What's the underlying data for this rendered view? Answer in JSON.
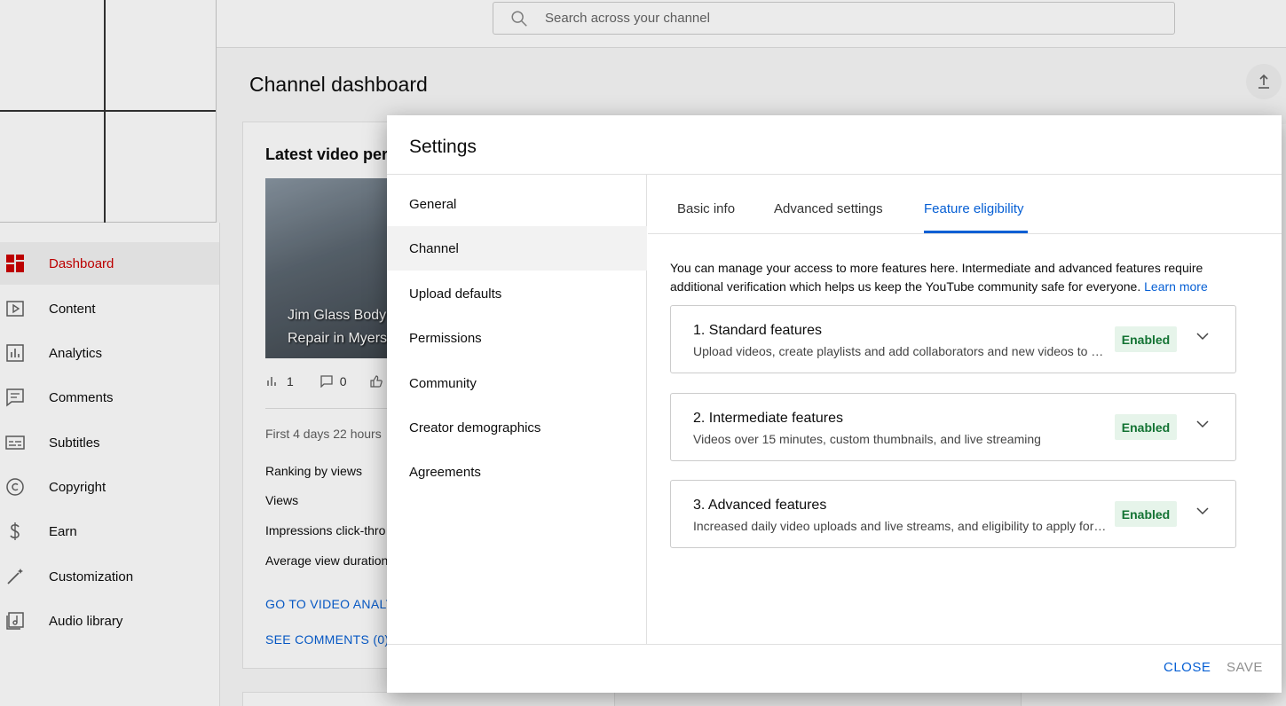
{
  "search": {
    "placeholder": "Search across your channel"
  },
  "page": {
    "title": "Channel dashboard"
  },
  "sidebar": {
    "items": [
      {
        "label": "Dashboard",
        "icon": "dashboard-icon",
        "active": true
      },
      {
        "label": "Content",
        "icon": "content-icon"
      },
      {
        "label": "Analytics",
        "icon": "analytics-icon"
      },
      {
        "label": "Comments",
        "icon": "comments-icon"
      },
      {
        "label": "Subtitles",
        "icon": "subtitles-icon"
      },
      {
        "label": "Copyright",
        "icon": "copyright-icon"
      },
      {
        "label": "Earn",
        "icon": "dollar-icon"
      },
      {
        "label": "Customization",
        "icon": "magic-wand-icon"
      },
      {
        "label": "Audio library",
        "icon": "audio-library-icon"
      }
    ]
  },
  "latest_video": {
    "title": "Latest video per",
    "thumb_line1": "Jim Glass Body",
    "thumb_line2": "Repair in Myers",
    "views_count": "1",
    "comments_count": "0",
    "period": "First 4 days 22 hours",
    "rows": [
      "Ranking by views",
      "Views",
      "Impressions click-thro",
      "Average view duration"
    ],
    "link_analytics": "GO TO VIDEO ANALY",
    "link_comments": "SEE COMMENTS (0)"
  },
  "dialog": {
    "title": "Settings",
    "left_nav": [
      "General",
      "Channel",
      "Upload defaults",
      "Permissions",
      "Community",
      "Creator demographics",
      "Agreements"
    ],
    "active_left": "Channel",
    "tabs": [
      "Basic info",
      "Advanced settings",
      "Feature eligibility"
    ],
    "active_tab": "Feature eligibility",
    "intro_text": "You can manage your access to more features here. Intermediate and advanced features require additional verification which helps us keep the YouTube community safe for everyone.",
    "learn_more": "Learn more",
    "features": [
      {
        "title": "1. Standard features",
        "description": "Upload videos, create playlists and add collaborators and new videos to playlists",
        "status": "Enabled"
      },
      {
        "title": "2. Intermediate features",
        "description": "Videos over 15 minutes, custom thumbnails, and live streaming",
        "status": "Enabled"
      },
      {
        "title": "3. Advanced features",
        "description": "Increased daily video uploads and live streams, and eligibility to apply for monetization",
        "status": "Enabled"
      }
    ],
    "close_label": "CLOSE",
    "save_label": "SAVE"
  },
  "colors": {
    "accent": "#065fd4",
    "brand_red": "#cc0000",
    "enabled_bg": "#e6f4ea",
    "enabled_text": "#137333"
  }
}
